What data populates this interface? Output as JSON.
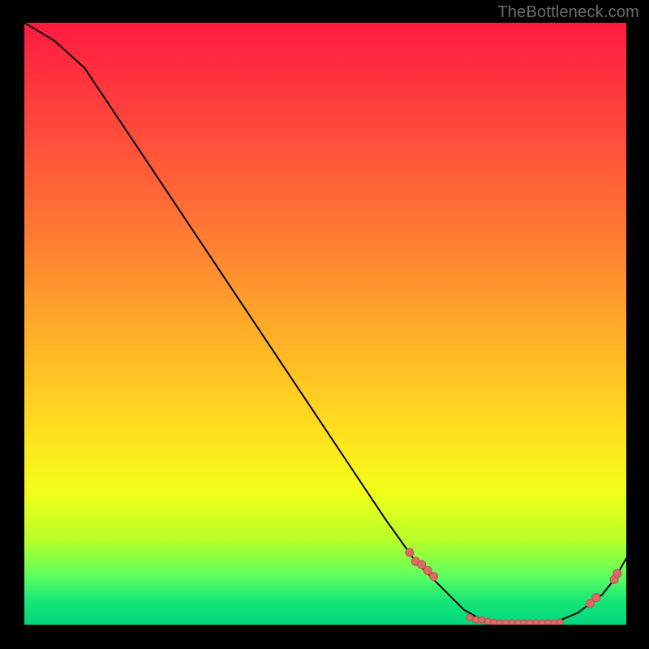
{
  "watermark": "TheBottleneck.com",
  "colors": {
    "marker_fill": "#dd6a66",
    "marker_stroke": "#c24f4d",
    "curve": "#000000"
  },
  "chart_data": {
    "type": "line",
    "title": "",
    "xlabel": "",
    "ylabel": "",
    "xlim": [
      0,
      100
    ],
    "ylim": [
      0,
      100
    ],
    "grid": false,
    "legend": false,
    "x": [
      0,
      5,
      10,
      15,
      20,
      25,
      30,
      35,
      40,
      45,
      50,
      55,
      60,
      65,
      70,
      73,
      76,
      80,
      84,
      88,
      92,
      96,
      98,
      100
    ],
    "values": [
      100,
      97,
      92.5,
      85,
      77.5,
      70,
      62.5,
      55,
      47.5,
      40,
      32.5,
      25,
      17.5,
      10.5,
      5.5,
      2.5,
      0.8,
      0.3,
      0.3,
      0.3,
      2,
      5,
      7.5,
      11
    ],
    "markers": {
      "x": [
        64,
        65,
        66,
        67,
        68,
        74,
        75,
        76,
        77,
        78,
        79,
        80,
        81,
        82,
        83,
        84,
        85,
        86,
        87,
        88,
        89,
        94,
        95,
        98,
        98.5
      ],
      "y": [
        12,
        10.5,
        10,
        9,
        8,
        1.2,
        0.8,
        0.8,
        0.5,
        0.4,
        0.3,
        0.3,
        0.3,
        0.3,
        0.3,
        0.3,
        0.3,
        0.3,
        0.3,
        0.3,
        0.4,
        3.5,
        4.5,
        7.5,
        8.5
      ],
      "r": [
        5,
        5,
        5,
        5,
        5,
        4,
        4,
        4,
        4,
        4,
        4,
        4,
        4,
        4,
        4,
        4,
        4,
        4,
        4,
        4,
        4,
        5,
        5,
        5,
        5
      ]
    }
  }
}
